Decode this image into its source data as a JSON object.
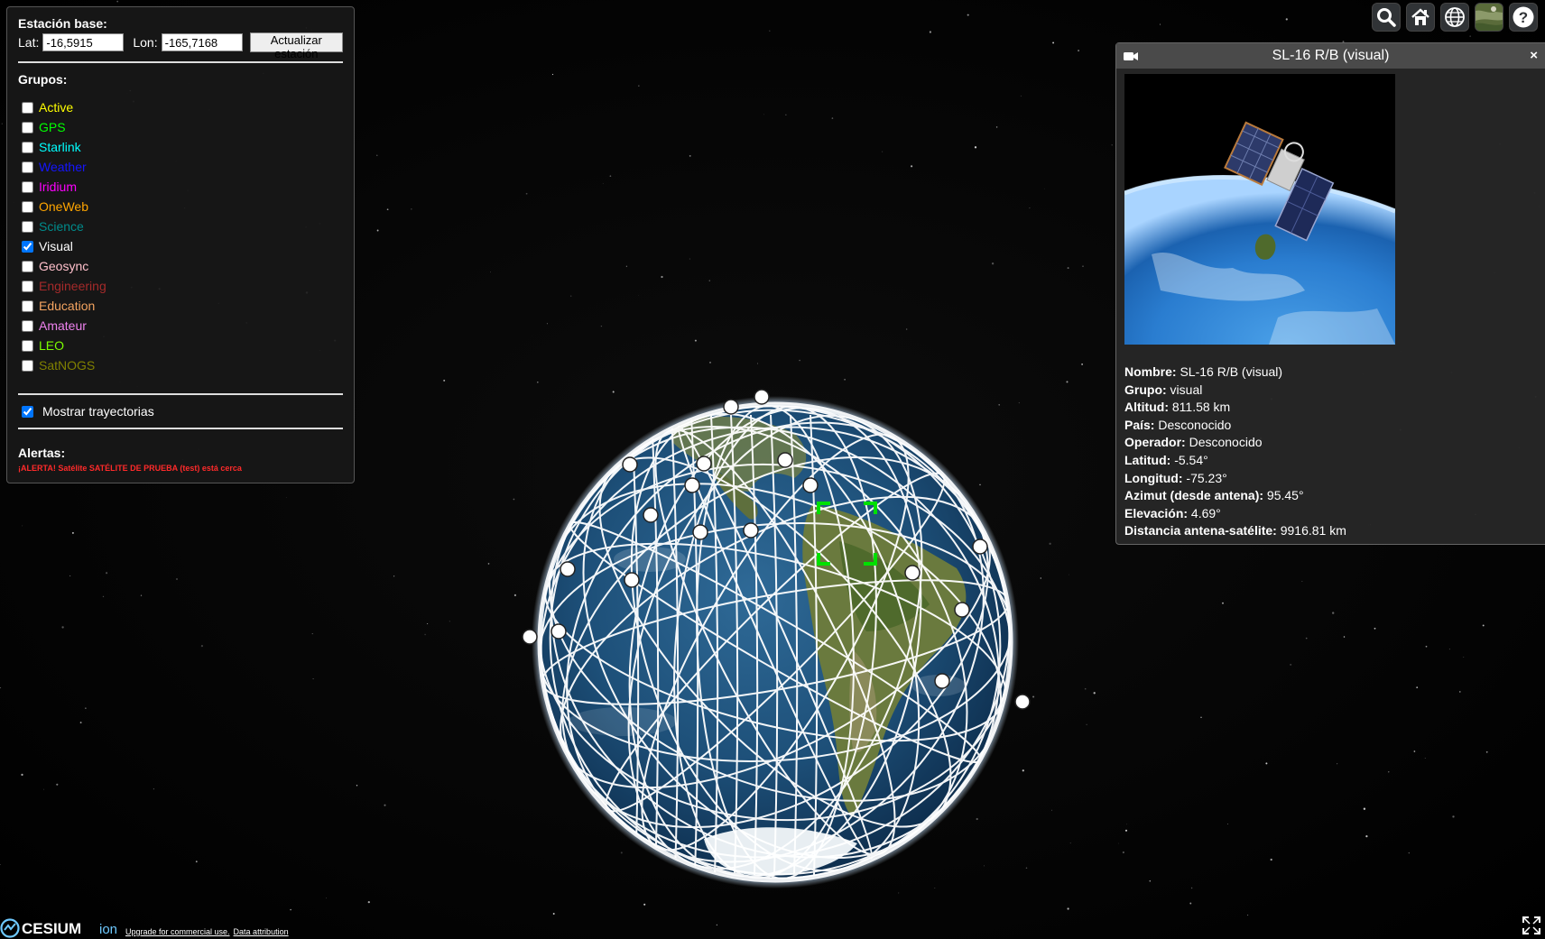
{
  "station": {
    "title": "Estación base:",
    "lat_label": "Lat:",
    "lat_value": "-16,5915",
    "lon_label": "Lon:",
    "lon_value": "-165,7168",
    "update_button": "Actualizar estación"
  },
  "groups": {
    "title": "Grupos:",
    "items": [
      {
        "label": "Active",
        "color": "#ffff00",
        "checked": false
      },
      {
        "label": "GPS",
        "color": "#00ff00",
        "checked": false
      },
      {
        "label": "Starlink",
        "color": "#00ffff",
        "checked": false
      },
      {
        "label": "Weather",
        "color": "#1515ff",
        "checked": false
      },
      {
        "label": "Iridium",
        "color": "#ff00ff",
        "checked": false
      },
      {
        "label": "OneWeb",
        "color": "#ffa500",
        "checked": false
      },
      {
        "label": "Science",
        "color": "#008b8b",
        "checked": false
      },
      {
        "label": "Visual",
        "color": "#ffffff",
        "checked": true
      },
      {
        "label": "Geosync",
        "color": "#ffc0cb",
        "checked": false
      },
      {
        "label": "Engineering",
        "color": "#a52a2a",
        "checked": false
      },
      {
        "label": "Education",
        "color": "#f4a460",
        "checked": false
      },
      {
        "label": "Amateur",
        "color": "#ee82ee",
        "checked": false
      },
      {
        "label": "LEO",
        "color": "#7cfc00",
        "checked": false
      },
      {
        "label": "SatNOGS",
        "color": "#808000",
        "checked": false
      }
    ]
  },
  "trajectories": {
    "label": "Mostrar trayectorias",
    "checked": true
  },
  "alerts": {
    "title": "Alertas:",
    "message": "¡ALERTA! Satélite SATÉLITE DE PRUEBA (test) está cerca"
  },
  "toolbar": {
    "icons": [
      "search-icon",
      "home-icon",
      "globe-icon",
      "imagery-icon",
      "help-icon"
    ]
  },
  "infobox": {
    "title": "SL-16 R/B (visual)",
    "fields": [
      {
        "label": "Nombre:",
        "value": "SL-16 R/B (visual)"
      },
      {
        "label": "Grupo:",
        "value": "visual"
      },
      {
        "label": "Altitud:",
        "value": "811.58 km"
      },
      {
        "label": "País:",
        "value": "Desconocido"
      },
      {
        "label": "Operador:",
        "value": "Desconocido"
      },
      {
        "label": "Latitud:",
        "value": "-5.54°"
      },
      {
        "label": "Longitud:",
        "value": "-75.23°"
      },
      {
        "label": "Azimut (desde antena):",
        "value": "95.45°"
      },
      {
        "label": "Elevación:",
        "value": "4.69°"
      },
      {
        "label": "Distancia antena-satélite:",
        "value": "9916.81 km"
      }
    ]
  },
  "credits": {
    "logo_main": "CESIUM",
    "logo_sub": "ion",
    "upgrade": "Upgrade for commercial use.",
    "attribution": "Data attribution"
  },
  "colors": {
    "panel_bg": "#181818",
    "alert": "#ff2a2a",
    "selection": "#00ff00",
    "orbit": "#ffffff"
  }
}
